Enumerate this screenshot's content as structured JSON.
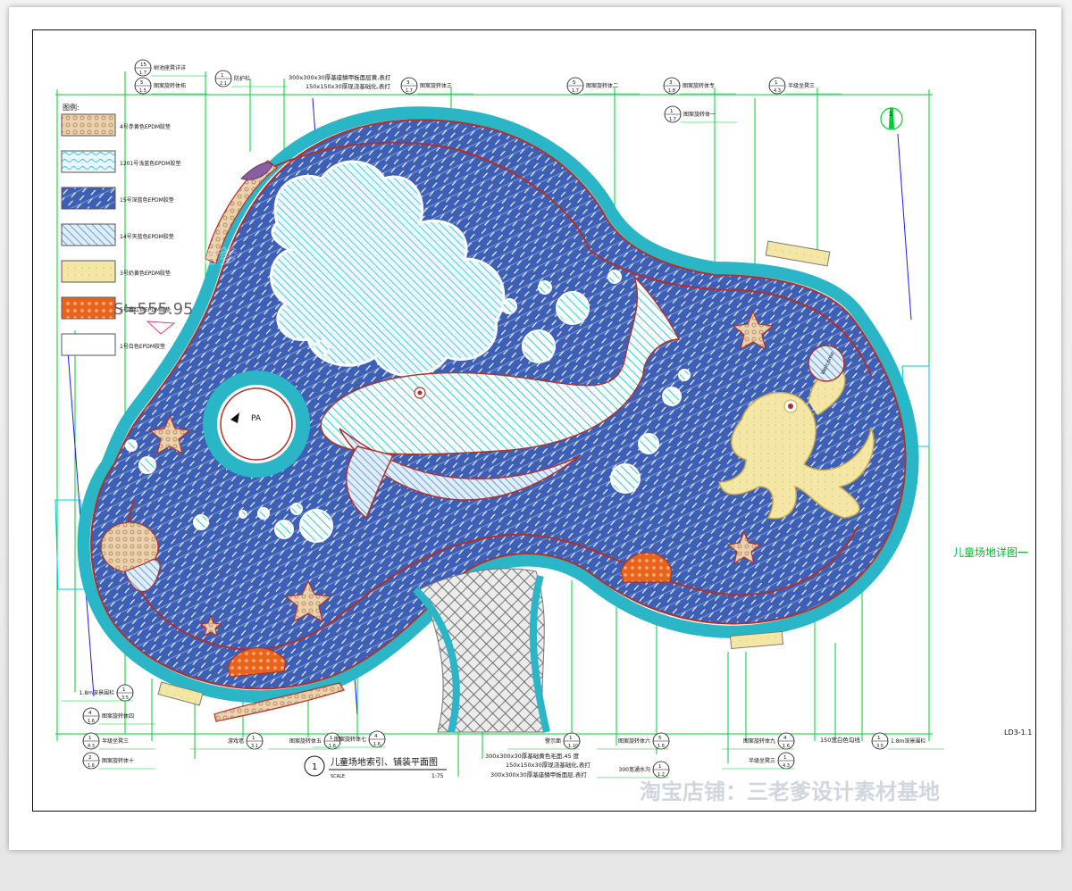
{
  "legend": {
    "title": "图例:",
    "items": [
      {
        "label": "4号赤黄色EPDM胶垫",
        "fill": "#d9a36a"
      },
      {
        "label": "1201号浅蓝色EPDM胶垫",
        "fill": "#7fd3ec"
      },
      {
        "label": "15号深蓝色EPDM胶垫",
        "fill": "#3e5fb7"
      },
      {
        "label": "14号天蓝色EPDM胶垫",
        "fill": "#9cc0e8"
      },
      {
        "label": "3号奶黄色EPDM胶垫",
        "fill": "#f6e9a8"
      },
      {
        "label": "5号橙红色EPDM胶垫",
        "fill": "#e8641d"
      },
      {
        "label": "1号白色EPDM胶垫",
        "fill": "#ffffff"
      }
    ],
    "overlay_text": "S≒555.95"
  },
  "plan": {
    "pa_label": "PA",
    "north_symbol": "1",
    "side_title": "儿童场地详图一",
    "sheet_code": "LD3-1.1",
    "main_title": {
      "num": "1",
      "text": "儿童场地索引、铺装平面图",
      "scale_word": "SCALE",
      "scale": "1:75"
    },
    "welcome": "Welcome"
  },
  "callouts_top": [
    {
      "ref": "15",
      "sheet": "1.7",
      "label": "树池座凳详详"
    },
    {
      "ref": "5",
      "sheet": "1.5",
      "label": "图案旋转体拓"
    },
    {
      "ref": "1",
      "sheet": "2.1",
      "label": "防护栏"
    },
    {
      "ref": "",
      "sheet": "",
      "label": "300x300x30厚基座鳞甲板面层黄,表打"
    },
    {
      "ref": "",
      "sheet": "",
      "label": "150x150x30厚现浇基础化,表打"
    },
    {
      "ref": "3",
      "sheet": "1.7",
      "label": "图案旋转体三"
    },
    {
      "ref": "5",
      "sheet": "1.7",
      "label": "图案旋转体二"
    },
    {
      "ref": "3",
      "sheet": "1.8",
      "label": "图案旋转体专"
    },
    {
      "ref": "1",
      "sheet": "1.7",
      "label": "图案旋转体一"
    },
    {
      "ref": "1",
      "sheet": "4.3",
      "label": "半级坐凳三"
    }
  ],
  "callouts_bottom": [
    {
      "ref": "1",
      "sheet": "3.5",
      "label": "1.8m深景围栏"
    },
    {
      "ref": "4",
      "sheet": "1.6",
      "label": "图案旋转体四"
    },
    {
      "ref": "1",
      "sheet": "4.3",
      "label": "半级坐凳三"
    },
    {
      "ref": "2",
      "sheet": "1.6",
      "label": "图案旋转体十"
    },
    {
      "ref": "1",
      "sheet": "3.1",
      "label": "游戏墙"
    },
    {
      "ref": "1",
      "sheet": "1.6",
      "label": "图案旋转体五"
    },
    {
      "ref": "4",
      "sheet": "1.6",
      "label": "图案旋转体七"
    },
    {
      "ref": "1",
      "sheet": "1.10",
      "label": "警示面"
    },
    {
      "ref": "",
      "sheet": "",
      "label": "300x300x30厚基础黄色毛面,45 度"
    },
    {
      "ref": "",
      "sheet": "",
      "label": "150x150x30厚现浇基础化,表打"
    },
    {
      "ref": "",
      "sheet": "",
      "label": "300x300x30厚基座鳞甲板面层,表打"
    },
    {
      "ref": "5",
      "sheet": "1.6",
      "label": "图案旋转体六"
    },
    {
      "ref": "1",
      "sheet": "1.2",
      "label": "300宽通水沟"
    },
    {
      "ref": "4",
      "sheet": "1.6",
      "label": "图案旋转体九"
    },
    {
      "ref": "1",
      "sheet": "4.3",
      "label": "半级坐凳三"
    },
    {
      "ref": "",
      "sheet": "",
      "label": "150宽白色勾线"
    },
    {
      "ref": "1",
      "sheet": "3.5",
      "label": "1.8m深景围栏"
    }
  ],
  "watermarks": {
    "brand": "三老爹",
    "store": "淘宝店铺：三老爹设计素材基地"
  },
  "colors": {
    "cad_green": "#00cc33",
    "cad_cyan": "#00c8d8",
    "deep_blue": "#2f4fa8",
    "outline_red": "#b0302a",
    "yellow": "#f4e7a6"
  }
}
